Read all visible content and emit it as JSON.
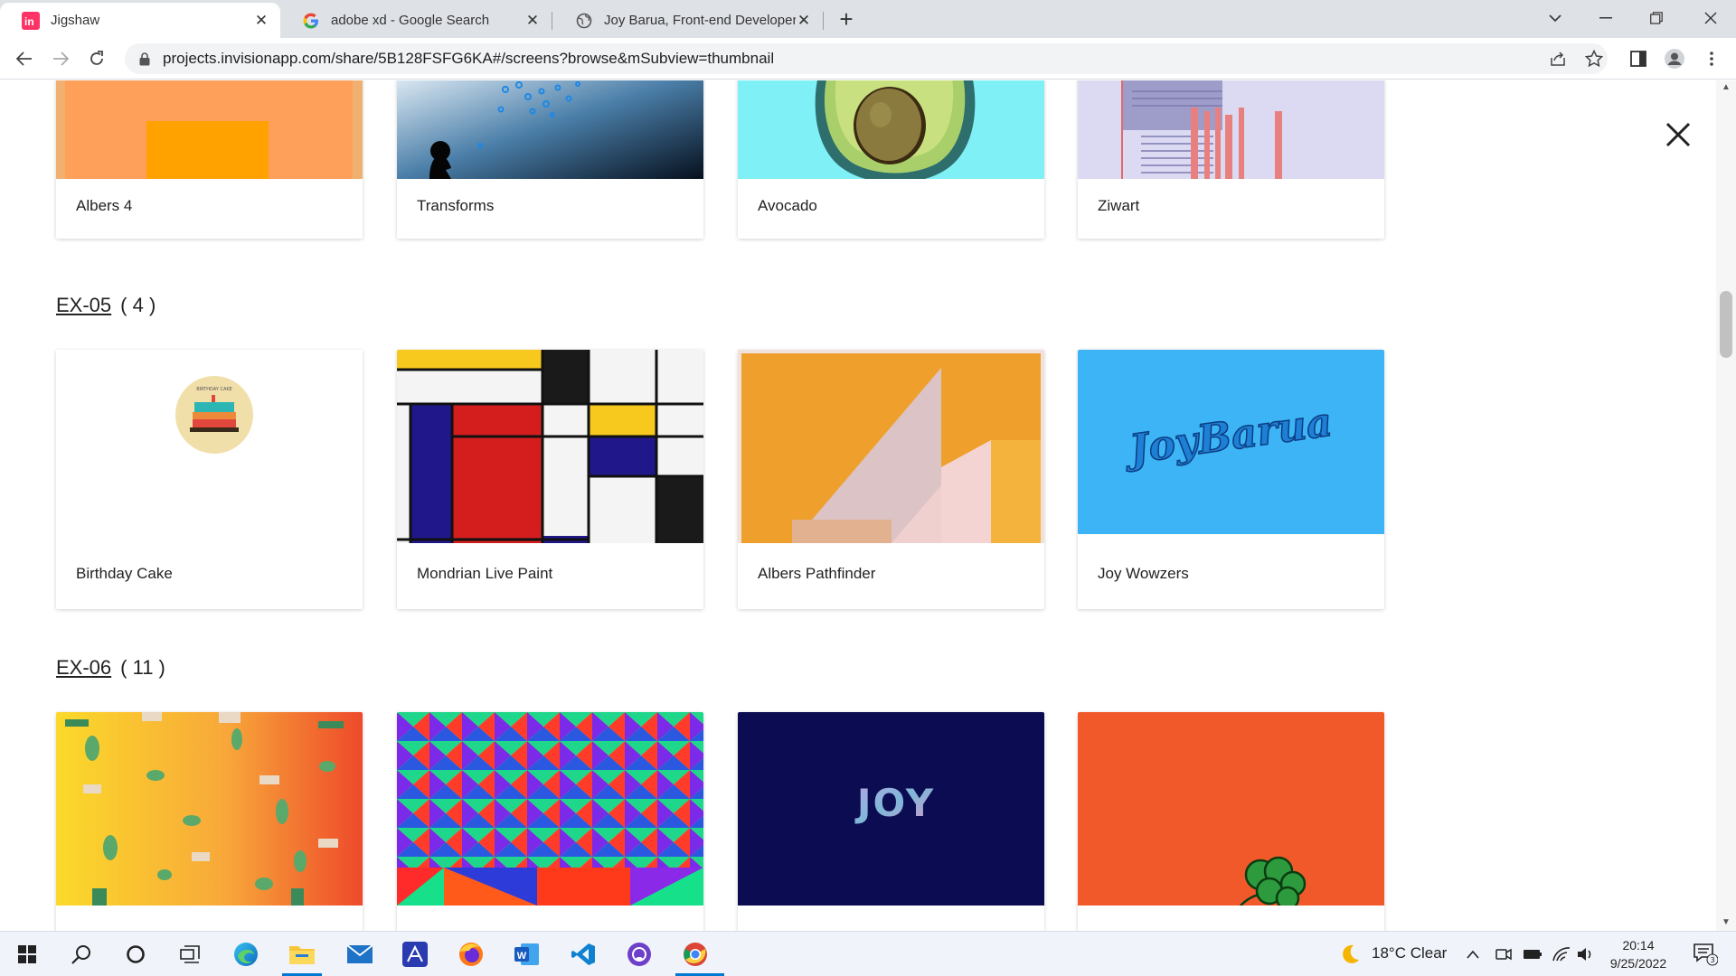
{
  "browser": {
    "tabs": [
      {
        "title": "Jigshaw",
        "favicon": "invision-icon",
        "active": true
      },
      {
        "title": "adobe xd - Google Search",
        "favicon": "google-icon",
        "active": false
      },
      {
        "title": "Joy Barua, Front-end Developer",
        "favicon": "globe-icon",
        "active": false
      }
    ],
    "url": "projects.invisionapp.com/share/5B128FSFG6KA#/screens?browse&mSubview=thumbnail"
  },
  "sections": {
    "top_row": {
      "cards": [
        {
          "label": "Albers 4"
        },
        {
          "label": "Transforms"
        },
        {
          "label": "Avocado"
        },
        {
          "label": "Ziwart"
        }
      ]
    },
    "ex05": {
      "name": "EX-05",
      "count": "( 4 )",
      "cards": [
        {
          "label": "Birthday Cake",
          "thumb_text": "BIRTHDAY CAKE"
        },
        {
          "label": "Mondrian Live Paint"
        },
        {
          "label": "Albers Pathfinder"
        },
        {
          "label": "Joy Wowzers",
          "thumb_text": "JoyBarua"
        }
      ]
    },
    "ex06": {
      "name": "EX-06",
      "count": "( 11 )",
      "cards": [
        {
          "label": ""
        },
        {
          "label": ""
        },
        {
          "label": "",
          "thumb_text": "JOY"
        },
        {
          "label": ""
        }
      ]
    }
  },
  "taskbar": {
    "weather": "18°C  Clear",
    "time": "20:14",
    "date": "9/25/2022",
    "notifications": "3"
  },
  "colors": {
    "chrome_tab_bg": "#dee1e6",
    "accent_blue": "#0078d4",
    "invision_pink": "#ff3366"
  }
}
